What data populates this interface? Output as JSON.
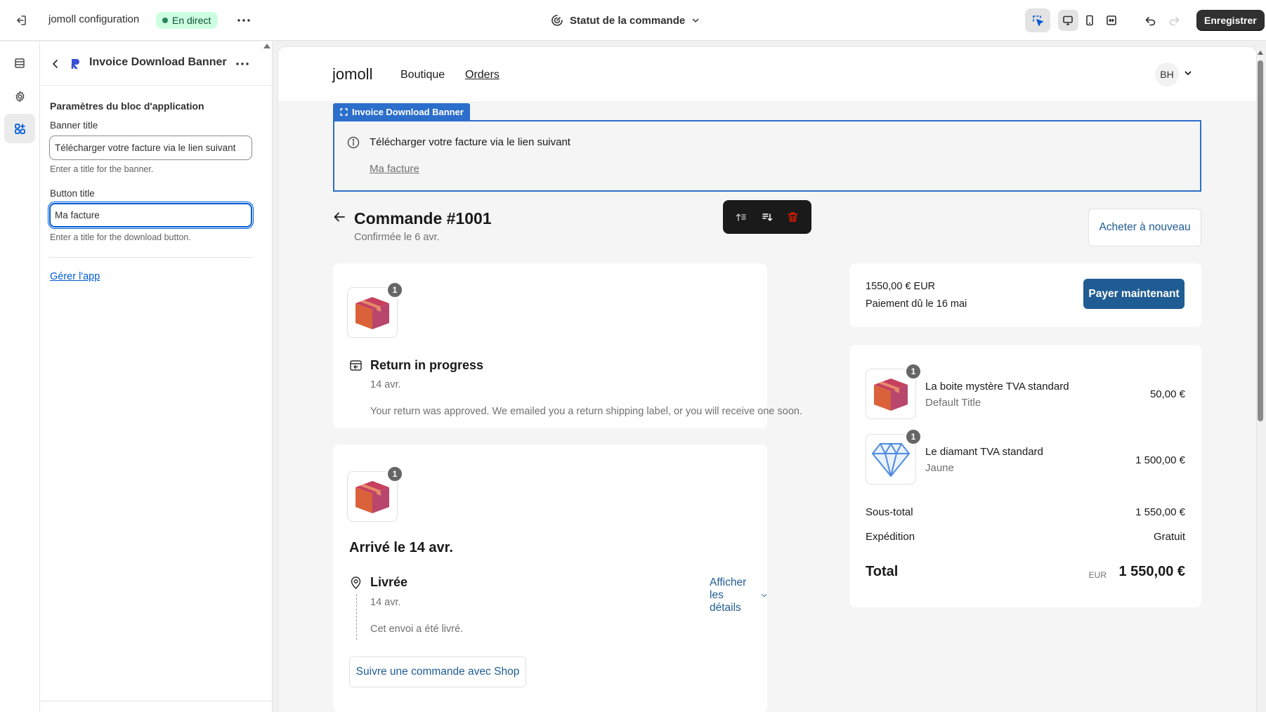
{
  "topbar": {
    "store_name": "jomoll configuration",
    "status_badge": "En direct",
    "page_selector": "Statut de la commande",
    "save_label": "Enregistrer"
  },
  "panel": {
    "block_title": "Invoice Download Banner",
    "section_title": "Paramètres du bloc d'application",
    "banner_title_label": "Banner title",
    "banner_title_value": "Télécharger votre facture via le lien suivant",
    "banner_title_help": "Enter a title for the banner.",
    "button_title_label": "Button title",
    "button_title_value": "Ma facture",
    "button_title_help": "Enter a title for the download button.",
    "manage_link": "Gérer l'app"
  },
  "store": {
    "logo": "jomoll",
    "nav": [
      "Boutique",
      "Orders"
    ],
    "avatar_initials": "BH"
  },
  "block_tag": "Invoice Download Banner",
  "banner": {
    "text": "Télécharger votre facture via le lien suivant",
    "link": "Ma facture"
  },
  "order": {
    "title": "Commande #1001",
    "confirmed": "Confirmée le 6 avr.",
    "buy_again": "Acheter à nouveau"
  },
  "return_card": {
    "qty": "1",
    "title": "Return in progress",
    "date": "14 avr.",
    "description": "Your return was approved. We emailed you a return shipping label, or you will receive one soon."
  },
  "delivery_card": {
    "qty": "1",
    "title": "Arrivé le 14 avr.",
    "status": "Livrée",
    "date": "14 avr.",
    "description": "Cet envoi a été livré.",
    "details_link": "Afficher les détails",
    "track_button": "Suivre une commande avec Shop"
  },
  "payment": {
    "amount": "1550,00 € EUR",
    "due": "Paiement dû le 16 mai",
    "pay_button": "Payer maintenant"
  },
  "summary": {
    "items": [
      {
        "qty": "1",
        "name": "La boite mystère TVA standard",
        "variant": "Default Title",
        "price": "50,00 €",
        "icon": "box-icon"
      },
      {
        "qty": "1",
        "name": "Le diamant TVA standard",
        "variant": "Jaune",
        "price": "1 500,00 €",
        "icon": "diamond-icon"
      }
    ],
    "subtotal_label": "Sous-total",
    "subtotal_value": "1 550,00 €",
    "shipping_label": "Expédition",
    "shipping_value": "Gratuit",
    "total_label": "Total",
    "total_currency": "EUR",
    "total_value": "1 550,00 €"
  },
  "colors": {
    "accent_blue": "#1f5c93",
    "editor_blue": "#2c6ecb",
    "live_badge_bg": "#cdfee1",
    "delete_red": "#e51c00"
  }
}
